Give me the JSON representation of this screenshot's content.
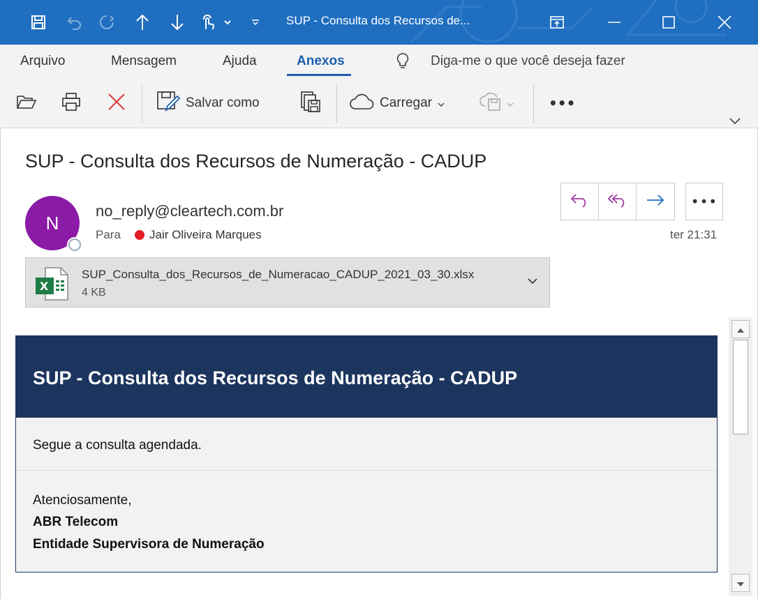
{
  "window": {
    "title": "SUP - Consulta dos Recursos de...",
    "controls": [
      "restore-icon",
      "minimize-icon",
      "maximize-icon",
      "close-icon"
    ],
    "quick_access": [
      "save-icon",
      "undo-icon",
      "redo-icon",
      "up-arrow-icon",
      "down-arrow-icon",
      "touch-mode-icon",
      "customize-dropdown-icon",
      "overflow-dropdown-icon"
    ]
  },
  "menu": {
    "items": [
      "Arquivo",
      "Mensagem",
      "Ajuda",
      "Anexos"
    ],
    "active": "Anexos",
    "search_placeholder": "Diga-me o que você deseja fazer"
  },
  "ribbon": {
    "save_as_label": "Salvar como",
    "upload_label": "Carregar",
    "more_label": "•••"
  },
  "message": {
    "subject": "SUP - Consulta dos Recursos de Numeração - CADUP",
    "avatar_initial": "N",
    "sender": "no_reply@cleartech.com.br",
    "to_label": "Para",
    "recipient": "Jair Oliveira Marques",
    "time": "ter 21:31",
    "more_label": "•••"
  },
  "attachment": {
    "name": "SUP_Consulta_dos_Recursos_de_Numeracao_CADUP_2021_03_30.xlsx",
    "size": "4 KB"
  },
  "body": {
    "header_title": "SUP - Consulta dos Recursos de Numeração - CADUP",
    "line1": "Segue a consulta agendada.",
    "closing": "Atenciosamente,",
    "org": "ABR Telecom",
    "dept": "Entidade Supervisora de Numeração"
  },
  "colors": {
    "titlebar": "#1f6ec0",
    "accent": "#1f5fb0",
    "avatar": "#8b1aa6",
    "mail_header": "#1c355e",
    "presence_busy": "#e51c23"
  }
}
